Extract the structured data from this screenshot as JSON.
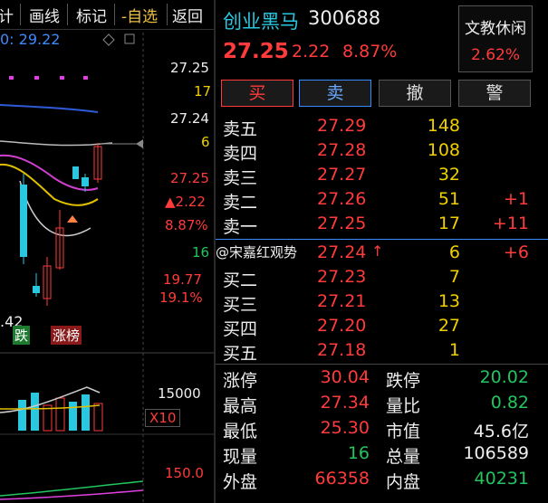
{
  "menu": {
    "items": [
      "计",
      "画线",
      "标记",
      "-自选",
      "返回"
    ]
  },
  "chart": {
    "ma_label": "0: 29.22",
    "price_scale": [
      "27.25",
      "27.24",
      "27.25",
      "19.77"
    ],
    "vol_scale_17": "17",
    "vol_scale_6": "6",
    "vol_scale_16": "16",
    "change": "▲2.22",
    "change_pct": "8.87%",
    "low_pct": "19.1%",
    "low_mark": ".42",
    "tag_fall": "跌",
    "tag_rise": "涨榜",
    "vol_value": "15000",
    "vol_multiplier": "X10",
    "indicator_value": "150.0"
  },
  "stock": {
    "name": "创业黑马",
    "code": "300688",
    "price": "27.25",
    "change": "2.22",
    "change_pct": "8.87%"
  },
  "sector": {
    "name": "文教休闲",
    "pct": "2.62%"
  },
  "buttons": {
    "buy": "买",
    "sell": "卖",
    "cancel": "撤",
    "alert": "警"
  },
  "asks": [
    {
      "label": "卖五",
      "price": "27.29",
      "vol": "148",
      "delta": ""
    },
    {
      "label": "卖四",
      "price": "27.28",
      "vol": "108",
      "delta": ""
    },
    {
      "label": "卖三",
      "price": "27.27",
      "vol": "32",
      "delta": ""
    },
    {
      "label": "卖二",
      "price": "27.26",
      "vol": "51",
      "delta": "+1"
    },
    {
      "label": "卖一",
      "price": "27.25",
      "vol": "17",
      "delta": "+11"
    }
  ],
  "bids": [
    {
      "label": "买一",
      "price": "27.24",
      "vol": "6",
      "delta": "+6"
    },
    {
      "label": "买二",
      "price": "27.23",
      "vol": "7",
      "delta": ""
    },
    {
      "label": "买三",
      "price": "27.21",
      "vol": "13",
      "delta": ""
    },
    {
      "label": "买四",
      "price": "27.20",
      "vol": "27",
      "delta": ""
    },
    {
      "label": "买五",
      "price": "27.18",
      "vol": "1",
      "delta": ""
    }
  ],
  "watermark": "@宋嘉红观势",
  "stats": [
    {
      "l1": "涨停",
      "v1": "30.04",
      "c1": "red",
      "l2": "跌停",
      "v2": "20.02",
      "c2": "green"
    },
    {
      "l1": "最高",
      "v1": "27.34",
      "c1": "red",
      "l2": "量比",
      "v2": "0.82",
      "c2": "green"
    },
    {
      "l1": "最低",
      "v1": "25.30",
      "c1": "red",
      "l2": "市值",
      "v2": "45.6亿",
      "c2": "white"
    },
    {
      "l1": "现量",
      "v1": "16",
      "c1": "green",
      "l2": "总量",
      "v2": "106589",
      "c2": "white"
    },
    {
      "l1": "外盘",
      "v1": "66358",
      "c1": "red",
      "l2": "内盘",
      "v2": "40231",
      "c2": "green"
    }
  ]
}
